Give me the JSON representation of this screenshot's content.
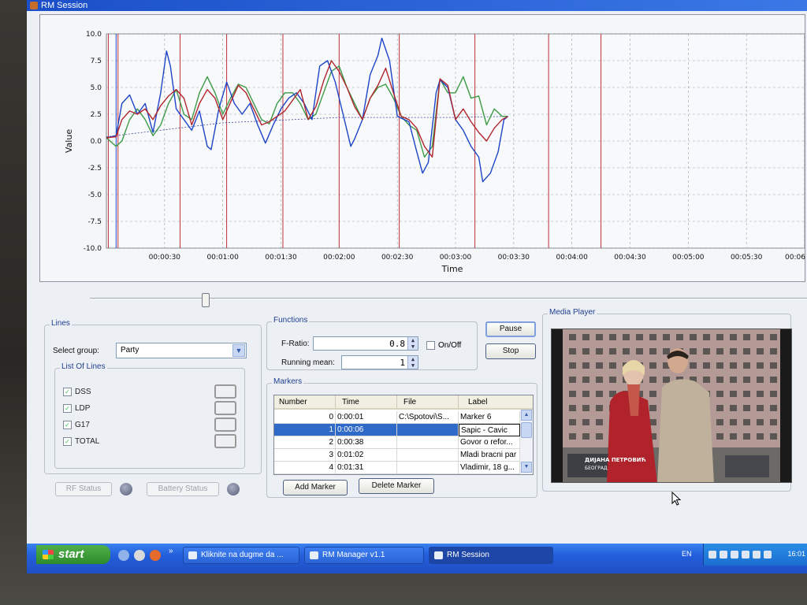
{
  "window": {
    "title": "RM Session"
  },
  "chart": {
    "ylabel": "Value",
    "xlabel": "Time",
    "ymin": -10,
    "ymax": 10,
    "yticks": [
      "10.0",
      "7.5",
      "5.0",
      "2.5",
      "0.0",
      "-2.5",
      "-5.0",
      "-7.5",
      "-10.0"
    ],
    "xticks": [
      "00:00:30",
      "00:01:00",
      "00:01:30",
      "00:02:00",
      "00:02:30",
      "00:03:00",
      "00:03:30",
      "00:04:00",
      "00:04:30",
      "00:05:00",
      "00:05:30",
      "00:06"
    ],
    "marker_seconds": [
      1,
      6,
      38,
      62,
      91,
      120,
      151,
      190,
      228,
      255
    ],
    "colors": {
      "dss": "#b0262d",
      "ldp": "#1c44c8",
      "g17": "#3d9a48",
      "total": "#6a2424",
      "grid": "#9aa3ad",
      "marker": "#c0303a"
    },
    "series_dss": [
      [
        0,
        0.3
      ],
      [
        5,
        0.4
      ],
      [
        8,
        2.0
      ],
      [
        12,
        2.8
      ],
      [
        16,
        2.5
      ],
      [
        20,
        3.0
      ],
      [
        24,
        2.0
      ],
      [
        28,
        3.3
      ],
      [
        32,
        4.2
      ],
      [
        36,
        4.8
      ],
      [
        40,
        4.0
      ],
      [
        44,
        1.5
      ],
      [
        48,
        3.5
      ],
      [
        52,
        4.8
      ],
      [
        56,
        4.0
      ],
      [
        60,
        2.0
      ],
      [
        64,
        3.6
      ],
      [
        68,
        5.2
      ],
      [
        72,
        4.5
      ],
      [
        76,
        3.0
      ],
      [
        80,
        1.5
      ],
      [
        84,
        1.8
      ],
      [
        88,
        2.3
      ],
      [
        92,
        2.8
      ],
      [
        96,
        3.8
      ],
      [
        100,
        4.8
      ],
      [
        104,
        2.0
      ],
      [
        108,
        3.2
      ],
      [
        112,
        5.6
      ],
      [
        116,
        7.5
      ],
      [
        120,
        6.5
      ],
      [
        124,
        5.0
      ],
      [
        128,
        3.2
      ],
      [
        132,
        2.0
      ],
      [
        136,
        4.0
      ],
      [
        140,
        5.2
      ],
      [
        144,
        6.8
      ],
      [
        148,
        4.5
      ],
      [
        152,
        2.3
      ],
      [
        156,
        2.0
      ],
      [
        160,
        1.2
      ],
      [
        164,
        -0.5
      ],
      [
        168,
        -1.5
      ],
      [
        172,
        5.8
      ],
      [
        176,
        5.2
      ],
      [
        180,
        2.0
      ],
      [
        184,
        3.0
      ],
      [
        188,
        1.8
      ],
      [
        192,
        0.8
      ],
      [
        196,
        0.0
      ],
      [
        200,
        1.2
      ],
      [
        204,
        2.0
      ],
      [
        207,
        2.3
      ]
    ],
    "series_ldp": [
      [
        0,
        0.3
      ],
      [
        5,
        0.5
      ],
      [
        8,
        3.5
      ],
      [
        12,
        4.3
      ],
      [
        16,
        2.5
      ],
      [
        20,
        3.5
      ],
      [
        24,
        0.8
      ],
      [
        28,
        4.5
      ],
      [
        31,
        8.4
      ],
      [
        33,
        7.0
      ],
      [
        36,
        3.0
      ],
      [
        40,
        2.0
      ],
      [
        44,
        1.0
      ],
      [
        48,
        2.8
      ],
      [
        52,
        -0.5
      ],
      [
        54,
        -0.8
      ],
      [
        58,
        3.0
      ],
      [
        62,
        5.5
      ],
      [
        66,
        3.5
      ],
      [
        70,
        2.5
      ],
      [
        74,
        3.5
      ],
      [
        78,
        1.5
      ],
      [
        82,
        -0.2
      ],
      [
        86,
        1.5
      ],
      [
        90,
        3.0
      ],
      [
        94,
        4.0
      ],
      [
        98,
        4.5
      ],
      [
        102,
        3.5
      ],
      [
        106,
        2.0
      ],
      [
        110,
        7.0
      ],
      [
        114,
        7.5
      ],
      [
        118,
        5.5
      ],
      [
        122,
        2.5
      ],
      [
        126,
        -0.5
      ],
      [
        128,
        0.2
      ],
      [
        132,
        2.0
      ],
      [
        136,
        6.2
      ],
      [
        140,
        8.0
      ],
      [
        142,
        9.6
      ],
      [
        146,
        7.5
      ],
      [
        150,
        2.3
      ],
      [
        156,
        1.8
      ],
      [
        160,
        -1.0
      ],
      [
        163,
        -3.0
      ],
      [
        166,
        -2.0
      ],
      [
        170,
        4.5
      ],
      [
        172,
        5.7
      ],
      [
        176,
        5.0
      ],
      [
        180,
        2.0
      ],
      [
        184,
        1.0
      ],
      [
        188,
        -0.5
      ],
      [
        192,
        -1.5
      ],
      [
        194,
        -3.8
      ],
      [
        198,
        -3.0
      ],
      [
        202,
        -1.0
      ],
      [
        205,
        2.0
      ],
      [
        207,
        2.3
      ]
    ],
    "series_g17": [
      [
        0,
        0.3
      ],
      [
        5,
        -0.5
      ],
      [
        8,
        0.0
      ],
      [
        12,
        2.0
      ],
      [
        16,
        3.0
      ],
      [
        20,
        2.0
      ],
      [
        24,
        0.5
      ],
      [
        28,
        1.5
      ],
      [
        32,
        3.5
      ],
      [
        36,
        4.8
      ],
      [
        40,
        2.5
      ],
      [
        44,
        2.0
      ],
      [
        48,
        4.5
      ],
      [
        52,
        6.0
      ],
      [
        56,
        4.5
      ],
      [
        60,
        2.5
      ],
      [
        64,
        4.0
      ],
      [
        68,
        5.3
      ],
      [
        72,
        5.0
      ],
      [
        76,
        3.5
      ],
      [
        80,
        2.0
      ],
      [
        84,
        1.6
      ],
      [
        88,
        3.5
      ],
      [
        92,
        4.5
      ],
      [
        96,
        4.5
      ],
      [
        100,
        3.5
      ],
      [
        104,
        2.0
      ],
      [
        108,
        2.5
      ],
      [
        112,
        4.5
      ],
      [
        116,
        6.5
      ],
      [
        120,
        7.0
      ],
      [
        124,
        5.0
      ],
      [
        128,
        3.5
      ],
      [
        132,
        2.0
      ],
      [
        136,
        4.0
      ],
      [
        140,
        5.0
      ],
      [
        144,
        5.3
      ],
      [
        148,
        4.0
      ],
      [
        152,
        2.3
      ],
      [
        156,
        1.5
      ],
      [
        160,
        1.0
      ],
      [
        164,
        -1.5
      ],
      [
        168,
        -0.5
      ],
      [
        172,
        5.8
      ],
      [
        176,
        4.5
      ],
      [
        180,
        4.5
      ],
      [
        184,
        6.0
      ],
      [
        188,
        4.0
      ],
      [
        192,
        4.2
      ],
      [
        196,
        1.5
      ],
      [
        200,
        3.0
      ],
      [
        204,
        2.3
      ],
      [
        207,
        2.3
      ]
    ],
    "series_total": [
      [
        0,
        0.4
      ],
      [
        60,
        1.7
      ],
      [
        120,
        2.2
      ],
      [
        180,
        2.2
      ],
      [
        207,
        2.3
      ]
    ]
  },
  "lines": {
    "title": "Lines",
    "select_label": "Select group:",
    "select_value": "Party",
    "list_title": "List Of Lines",
    "items": [
      {
        "label": "DSS",
        "color": "#b0262d"
      },
      {
        "label": "LDP",
        "color": "#1c44c8"
      },
      {
        "label": "G17",
        "color": "#3d9a48"
      },
      {
        "label": "TOTAL",
        "color": "#8a8f96"
      }
    ]
  },
  "status": {
    "rf": "RF Status",
    "battery": "Battery Status"
  },
  "functions": {
    "title": "Functions",
    "fratio_label": "F-Ratio:",
    "fratio_value": "0.8",
    "onoff_label": "On/Off",
    "mean_label": "Running mean:",
    "mean_value": "1"
  },
  "buttons": {
    "pause": "Pause",
    "stop": "Stop",
    "add_marker": "Add Marker",
    "delete_marker": "Delete Marker"
  },
  "markers": {
    "title": "Markers",
    "headers": [
      "Number",
      "Time",
      "File",
      "Label"
    ],
    "rows": [
      [
        "0",
        "0:00:01",
        "C:\\Spotovi\\S...",
        "Marker 6"
      ],
      [
        "1",
        "0:00:06",
        "",
        "Sapic - Cavic"
      ],
      [
        "2",
        "0:00:38",
        "",
        "Govor o refor..."
      ],
      [
        "3",
        "0:01:02",
        "",
        "Mladi bracni par"
      ],
      [
        "4",
        "0:01:31",
        "",
        "Vladimir, 18 g..."
      ]
    ]
  },
  "media": {
    "title": "Media Player",
    "caption_name": "ДИЈАНА ПЕТРОВИЋ",
    "caption_city": "БЕОГРАД"
  },
  "taskbar": {
    "start": "start",
    "tasks": [
      "Kliknite na dugme da ...",
      "RM Manager v1.1",
      "RM Session"
    ],
    "lang": "EN",
    "clock": "16:01"
  }
}
